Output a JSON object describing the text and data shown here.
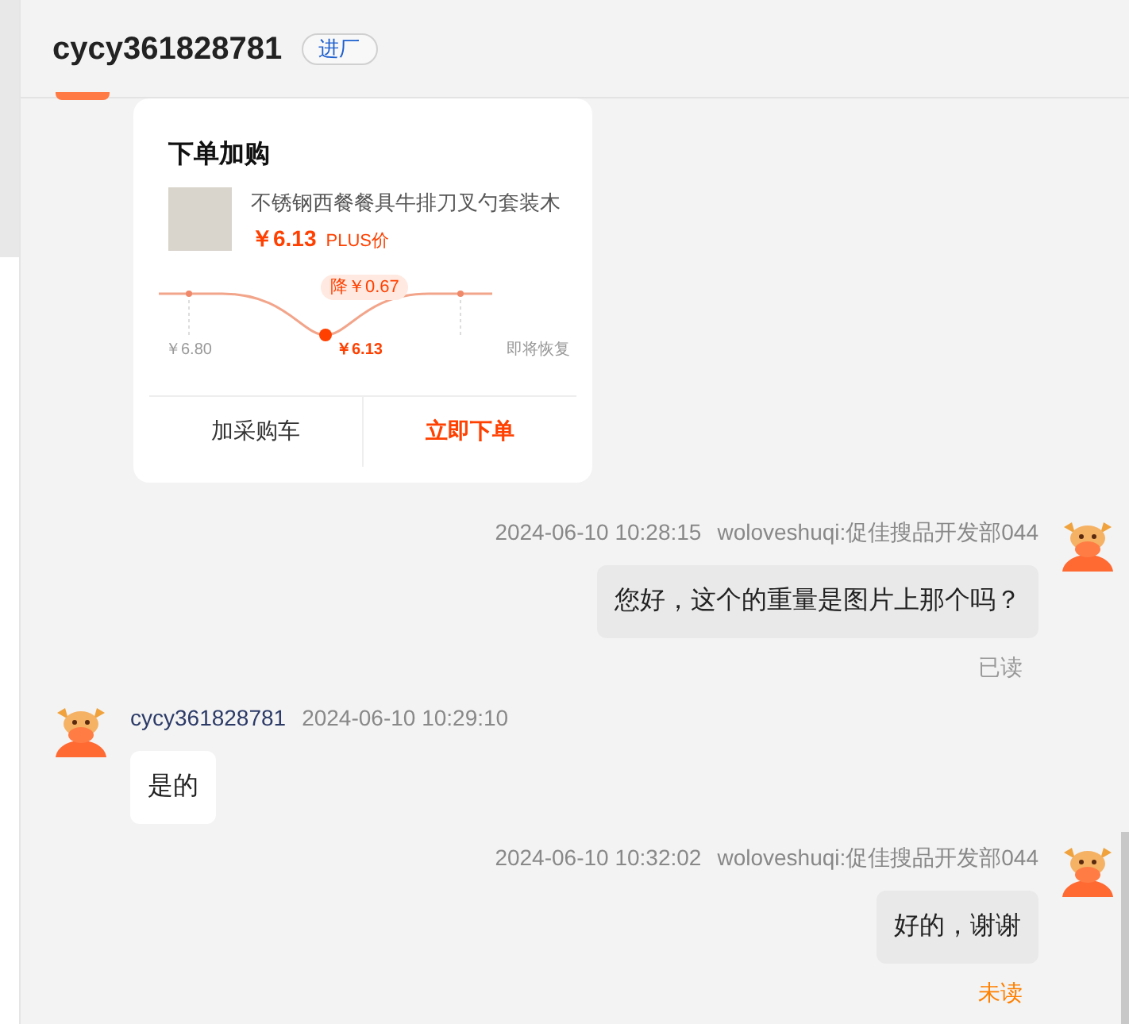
{
  "header": {
    "title": "cycy361828781",
    "badge": "进厂"
  },
  "card": {
    "title": "下单加购",
    "product": {
      "name": "不锈钢西餐餐具牛排刀叉勺套装木",
      "price": "￥6.13",
      "price_tag": "PLUS价"
    },
    "price_curve": {
      "drop": "降￥0.67",
      "labels": [
        {
          "text": "￥6.80",
          "kind": "old"
        },
        {
          "text": "￥6.13",
          "kind": "now"
        },
        {
          "text": "即将恢复",
          "kind": "future"
        }
      ]
    },
    "buttons": [
      {
        "label": "加采购车",
        "kind": "secondary"
      },
      {
        "label": "立即下单",
        "kind": "primary"
      }
    ]
  },
  "messages": [
    {
      "kind": "sent",
      "time": "2024-06-10 10:28:15",
      "sender": "woloveshuqi:促佳搜品开发部044",
      "text": "您好，这个的重量是图片上那个吗？",
      "status": "已读",
      "read": true
    },
    {
      "kind": "received",
      "time": "2024-06-10 10:29:10",
      "sender": "cycy361828781",
      "text": "是的"
    },
    {
      "kind": "sent",
      "time": "2024-06-10 10:32:02",
      "sender": "woloveshuqi:促佳搜品开发部044",
      "text": "好的，谢谢",
      "status": "未读",
      "read": false
    }
  ]
}
